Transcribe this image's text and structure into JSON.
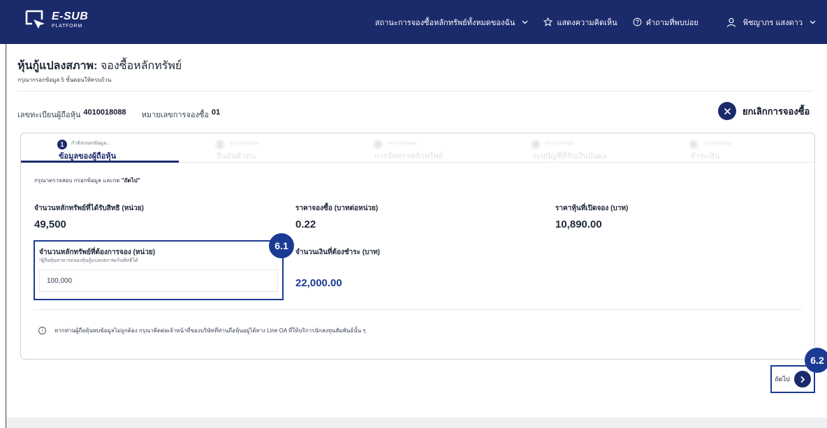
{
  "header": {
    "logo_main": "E-SUB",
    "logo_sub": "PLATFORM",
    "nav": [
      {
        "label": "สถานะการจองซื้อหลักทรัพย์ทั้งหมดของฉัน",
        "icon": "chevron-down-icon"
      },
      {
        "label": "แสดงความคิดเห็น",
        "icon": "star-icon"
      },
      {
        "label": "คำถามที่พบบ่อย",
        "icon": "help-icon"
      },
      {
        "label": "พิชญาภร แสงดาว",
        "icon": "user-icon"
      }
    ],
    "colors": {
      "topbar": "#1b2a6b",
      "accent": "#1b3a94"
    }
  },
  "page": {
    "title_bold": "หุ้นกู้แปลงสภาพ:",
    "title_rest": "จองซื้อหลักทรัพย์",
    "subtitle": "กรุณากรอกข้อมูล 5 ขั้นตอนให้ครบถ้วน",
    "registration_label": "เลขทะเบียนผู้ถือหุ้น",
    "registration_value": "4010018088",
    "booking_label": "หมายเลขการจองซื้อ",
    "booking_value": "01",
    "cancel_label": "ยกเลิกการจองซื้อ",
    "cancel_icon": "close-icon"
  },
  "steps": [
    {
      "num": "1",
      "status": "กำลังกรอกข้อมูล...",
      "name": "ข้อมูลของผู้ถือหุ้น",
      "active": true
    },
    {
      "num": "2",
      "status": "รอกรอกข้อมูล",
      "name": "ยืนยันตัวตน",
      "active": false
    },
    {
      "num": "3",
      "status": "รอกรอกข้อมูล",
      "name": "การจัดสรรหลักทรัพย์",
      "active": false
    },
    {
      "num": "4",
      "status": "รอกรอกข้อมูล",
      "name": "ระบุบัญชีที่รับเงินปันผล",
      "active": false
    },
    {
      "num": "5",
      "status": "รอกรอกข้อมูล",
      "name": "ชำระเงิน",
      "active": false
    }
  ],
  "form": {
    "instruction_prefix": "กรุณาตรวจสอบ กรอกข้อมูล และกด",
    "instruction_bold": "\"ถัดไป\"",
    "entitled_label": "จำนวนหลักทรัพย์ที่ได้รับสิทธิ (หน่วย)",
    "entitled_value": "49,500",
    "price_label": "ราคาจองซื้อ (บาทต่อหน่วย)",
    "price_value": "0.22",
    "open_value_label": "ราคาหุ้นที่เปิดจอง (บาท)",
    "open_value": "10,890.00",
    "desired_label": "จำนวนหลักทรัพย์ที่ต้องการจอง (หน่วย)",
    "desired_hint": "*ผู้ถือหุ้นสามารถจองหุ้นกู้แปลงสภาพเกินสิทธิได้",
    "desired_value": "100,000",
    "pay_label": "จำนวนเงินที่ต้องชำระ (บาท)",
    "pay_value": "22,000.00",
    "info_text": "หากท่านผู้ถือหุ้นพบข้อมูลไม่ถูกต้อง กรุณาติดต่อเจ้าหน้าที่ของบริษัทที่ท่านถือหุ้นอยู่ได้ทาง Line OA ที่ให้บริการนักลงทุนสัมพันธ์นั้น ๆ"
  },
  "annotations": {
    "badge_1": "6.1",
    "badge_2": "6.2"
  },
  "footer": {
    "next_label": "ถัดไป",
    "next_icon": "chevron-right-icon"
  }
}
